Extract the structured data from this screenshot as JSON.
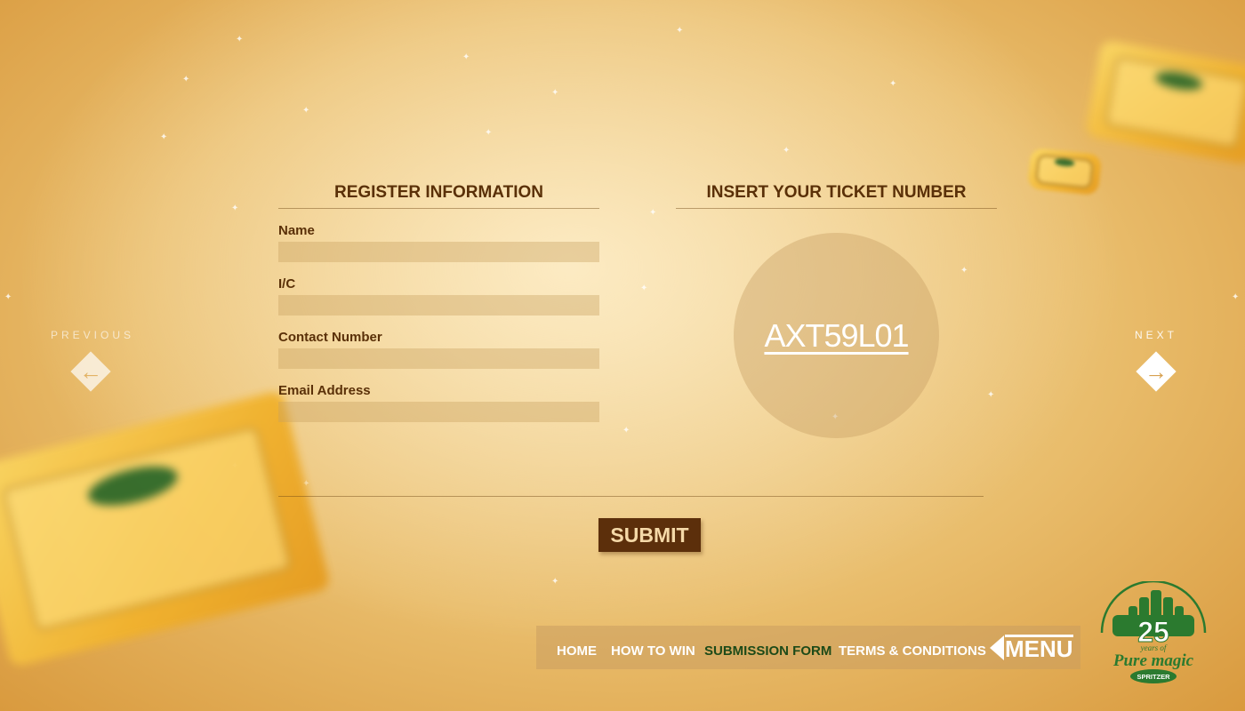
{
  "nav": {
    "previous_label": "PREVIOUS",
    "next_label": "NEXT"
  },
  "register": {
    "title": "REGISTER INFORMATION",
    "fields": [
      {
        "label": "Name",
        "value": ""
      },
      {
        "label": "I/C",
        "value": ""
      },
      {
        "label": "Contact Number",
        "value": ""
      },
      {
        "label": "Email Address",
        "value": ""
      }
    ]
  },
  "ticket": {
    "title": "INSERT YOUR TICKET NUMBER",
    "code": "AXT59L01"
  },
  "submit_label": "SUBMIT",
  "menu": {
    "items": [
      {
        "label": "HOME",
        "active": false
      },
      {
        "label": "HOW TO WIN",
        "active": false
      },
      {
        "label": "SUBMISSION FORM",
        "active": true
      },
      {
        "label": "TERMS & CONDITIONS",
        "active": false
      }
    ],
    "toggle_label": "MENU"
  },
  "logo": {
    "number": "25",
    "line1": "years of",
    "line2": "Pure magic",
    "brand": "SPRITZER"
  },
  "colors": {
    "heading": "#5a3008",
    "button_bg": "#5c2f0b",
    "active_menu": "#1d4a18",
    "logo_green": "#2b7a2f"
  }
}
